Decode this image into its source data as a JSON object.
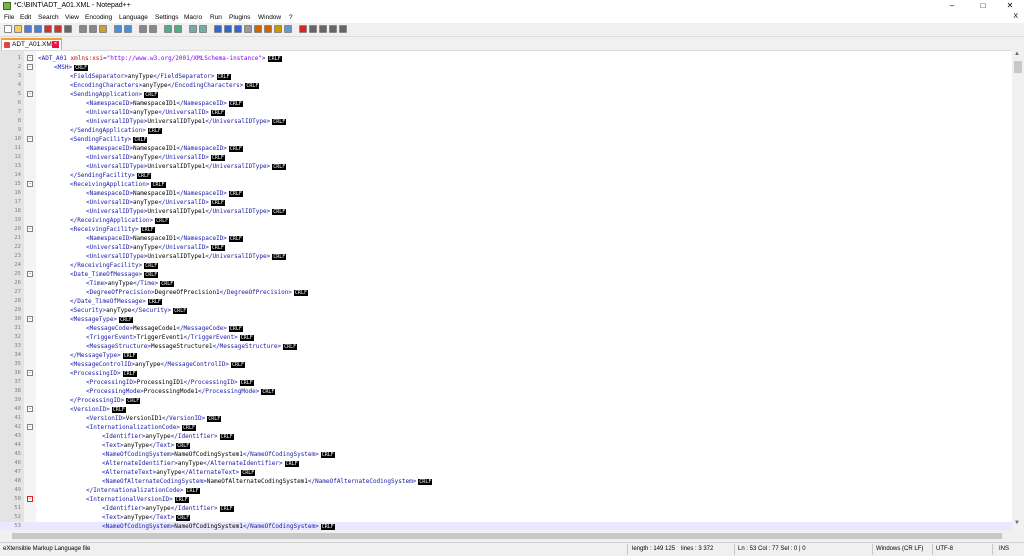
{
  "window": {
    "title": "*C:\\BINT\\ADT_A01.XML - Notepad++",
    "minimize": "–",
    "maximize": "□",
    "close": "✕"
  },
  "menu": [
    "File",
    "Edit",
    "Search",
    "View",
    "Encoding",
    "Language",
    "Settings",
    "Macro",
    "Run",
    "Plugins",
    "Window",
    "?"
  ],
  "menu_close": "X",
  "toolbar_icons": [
    "new-file-icon",
    "open-file-icon",
    "save-icon",
    "save-all-icon",
    "close-icon",
    "close-all-icon",
    "print-icon",
    "cut-icon",
    "copy-icon",
    "paste-icon",
    "undo-icon",
    "redo-icon",
    "find-icon",
    "replace-icon",
    "zoom-in-icon",
    "zoom-out-icon",
    "sync-vertical-icon",
    "sync-horizontal-icon",
    "word-wrap-icon",
    "show-all-chars-icon",
    "indent-guide-icon",
    "user-lang-icon",
    "doc-map-icon",
    "function-list-icon",
    "folder-workspace-icon",
    "monitoring-icon",
    "record-macro-icon",
    "stop-record-icon",
    "playback-icon",
    "run-macro-icon",
    "save-macro-icon"
  ],
  "tab": {
    "label": "ADT_A01.XML"
  },
  "crlf": "CRLF",
  "lines": [
    {
      "n": "1",
      "indent": 0,
      "segs": [
        [
          "t",
          "<ADT_A01 "
        ],
        [
          "a",
          "xmlns:xsi"
        ],
        [
          "t",
          "="
        ],
        [
          "v",
          "\"http://www.w3.org/2001/XMLSchema-instance\""
        ],
        [
          "t",
          ">"
        ]
      ]
    },
    {
      "n": "2",
      "indent": 1,
      "segs": [
        [
          "t",
          "<MSH>"
        ]
      ]
    },
    {
      "n": "3",
      "indent": 2,
      "segs": [
        [
          "t",
          "<FieldSeparator>"
        ],
        [
          "x",
          "anyType"
        ],
        [
          "t",
          "</FieldSeparator>"
        ]
      ]
    },
    {
      "n": "4",
      "indent": 2,
      "segs": [
        [
          "t",
          "<EncodingCharacters>"
        ],
        [
          "x",
          "anyType"
        ],
        [
          "t",
          "</EncodingCharacters>"
        ]
      ]
    },
    {
      "n": "5",
      "indent": 2,
      "segs": [
        [
          "t",
          "<SendingApplication>"
        ]
      ]
    },
    {
      "n": "6",
      "indent": 3,
      "segs": [
        [
          "t",
          "<NamespaceID>"
        ],
        [
          "x",
          "NamespaceID1"
        ],
        [
          "t",
          "</NamespaceID>"
        ]
      ]
    },
    {
      "n": "7",
      "indent": 3,
      "segs": [
        [
          "t",
          "<UniversalID>"
        ],
        [
          "x",
          "anyType"
        ],
        [
          "t",
          "</UniversalID>"
        ]
      ]
    },
    {
      "n": "8",
      "indent": 3,
      "segs": [
        [
          "t",
          "<UniversalIDType>"
        ],
        [
          "x",
          "UniversalIDType1"
        ],
        [
          "t",
          "</UniversalIDType>"
        ]
      ]
    },
    {
      "n": "9",
      "indent": 2,
      "segs": [
        [
          "t",
          "</SendingApplication>"
        ]
      ]
    },
    {
      "n": "10",
      "indent": 2,
      "segs": [
        [
          "t",
          "<SendingFacility>"
        ]
      ]
    },
    {
      "n": "11",
      "indent": 3,
      "segs": [
        [
          "t",
          "<NamespaceID>"
        ],
        [
          "x",
          "NamespaceID1"
        ],
        [
          "t",
          "</NamespaceID>"
        ]
      ]
    },
    {
      "n": "12",
      "indent": 3,
      "segs": [
        [
          "t",
          "<UniversalID>"
        ],
        [
          "x",
          "anyType"
        ],
        [
          "t",
          "</UniversalID>"
        ]
      ]
    },
    {
      "n": "13",
      "indent": 3,
      "segs": [
        [
          "t",
          "<UniversalIDType>"
        ],
        [
          "x",
          "UniversalIDType1"
        ],
        [
          "t",
          "</UniversalIDType>"
        ]
      ]
    },
    {
      "n": "14",
      "indent": 2,
      "segs": [
        [
          "t",
          "</SendingFacility>"
        ]
      ]
    },
    {
      "n": "15",
      "indent": 2,
      "segs": [
        [
          "t",
          "<ReceivingApplication>"
        ]
      ]
    },
    {
      "n": "16",
      "indent": 3,
      "segs": [
        [
          "t",
          "<NamespaceID>"
        ],
        [
          "x",
          "NamespaceID1"
        ],
        [
          "t",
          "</NamespaceID>"
        ]
      ]
    },
    {
      "n": "17",
      "indent": 3,
      "segs": [
        [
          "t",
          "<UniversalID>"
        ],
        [
          "x",
          "anyType"
        ],
        [
          "t",
          "</UniversalID>"
        ]
      ]
    },
    {
      "n": "18",
      "indent": 3,
      "segs": [
        [
          "t",
          "<UniversalIDType>"
        ],
        [
          "x",
          "UniversalIDType1"
        ],
        [
          "t",
          "</UniversalIDType>"
        ]
      ]
    },
    {
      "n": "19",
      "indent": 2,
      "segs": [
        [
          "t",
          "</ReceivingApplication>"
        ]
      ]
    },
    {
      "n": "20",
      "indent": 2,
      "segs": [
        [
          "t",
          "<ReceivingFacility>"
        ]
      ]
    },
    {
      "n": "21",
      "indent": 3,
      "segs": [
        [
          "t",
          "<NamespaceID>"
        ],
        [
          "x",
          "NamespaceID1"
        ],
        [
          "t",
          "</NamespaceID>"
        ]
      ]
    },
    {
      "n": "22",
      "indent": 3,
      "segs": [
        [
          "t",
          "<UniversalID>"
        ],
        [
          "x",
          "anyType"
        ],
        [
          "t",
          "</UniversalID>"
        ]
      ]
    },
    {
      "n": "23",
      "indent": 3,
      "segs": [
        [
          "t",
          "<UniversalIDType>"
        ],
        [
          "x",
          "UniversalIDType1"
        ],
        [
          "t",
          "</UniversalIDType>"
        ]
      ]
    },
    {
      "n": "24",
      "indent": 2,
      "segs": [
        [
          "t",
          "</ReceivingFacility>"
        ]
      ]
    },
    {
      "n": "25",
      "indent": 2,
      "segs": [
        [
          "t",
          "<Date_TimeOfMessage>"
        ]
      ]
    },
    {
      "n": "26",
      "indent": 3,
      "segs": [
        [
          "t",
          "<Time>"
        ],
        [
          "x",
          "anyType"
        ],
        [
          "t",
          "</Time>"
        ]
      ]
    },
    {
      "n": "27",
      "indent": 3,
      "segs": [
        [
          "t",
          "<DegreeOfPrecision>"
        ],
        [
          "x",
          "DegreeOfPrecision1"
        ],
        [
          "t",
          "</DegreeOfPrecision>"
        ]
      ]
    },
    {
      "n": "28",
      "indent": 2,
      "segs": [
        [
          "t",
          "</Date_TimeOfMessage>"
        ]
      ]
    },
    {
      "n": "29",
      "indent": 2,
      "segs": [
        [
          "t",
          "<Security>"
        ],
        [
          "x",
          "anyType"
        ],
        [
          "t",
          "</Security>"
        ]
      ]
    },
    {
      "n": "30",
      "indent": 2,
      "segs": [
        [
          "t",
          "<MessageType>"
        ]
      ]
    },
    {
      "n": "31",
      "indent": 3,
      "segs": [
        [
          "t",
          "<MessageCode>"
        ],
        [
          "x",
          "MessageCode1"
        ],
        [
          "t",
          "</MessageCode>"
        ]
      ]
    },
    {
      "n": "32",
      "indent": 3,
      "segs": [
        [
          "t",
          "<TriggerEvent>"
        ],
        [
          "x",
          "TriggerEvent1"
        ],
        [
          "t",
          "</TriggerEvent>"
        ]
      ]
    },
    {
      "n": "33",
      "indent": 3,
      "segs": [
        [
          "t",
          "<MessageStructure>"
        ],
        [
          "x",
          "MessageStructure1"
        ],
        [
          "t",
          "</MessageStructure>"
        ]
      ]
    },
    {
      "n": "34",
      "indent": 2,
      "segs": [
        [
          "t",
          "</MessageType>"
        ]
      ]
    },
    {
      "n": "35",
      "indent": 2,
      "segs": [
        [
          "t",
          "<MessageControlID>"
        ],
        [
          "x",
          "anyType"
        ],
        [
          "t",
          "</MessageControlID>"
        ]
      ]
    },
    {
      "n": "36",
      "indent": 2,
      "segs": [
        [
          "t",
          "<ProcessingID>"
        ]
      ]
    },
    {
      "n": "37",
      "indent": 3,
      "segs": [
        [
          "t",
          "<ProcessingID>"
        ],
        [
          "x",
          "ProcessingID1"
        ],
        [
          "t",
          "</ProcessingID>"
        ]
      ]
    },
    {
      "n": "38",
      "indent": 3,
      "segs": [
        [
          "t",
          "<ProcessingMode>"
        ],
        [
          "x",
          "ProcessingMode1"
        ],
        [
          "t",
          "</ProcessingMode>"
        ]
      ]
    },
    {
      "n": "39",
      "indent": 2,
      "segs": [
        [
          "t",
          "</ProcessingID>"
        ]
      ]
    },
    {
      "n": "40",
      "indent": 2,
      "segs": [
        [
          "t",
          "<VersionID>"
        ]
      ]
    },
    {
      "n": "41",
      "indent": 3,
      "segs": [
        [
          "t",
          "<VersionID>"
        ],
        [
          "x",
          "VersionID1"
        ],
        [
          "t",
          "</VersionID>"
        ]
      ]
    },
    {
      "n": "42",
      "indent": 3,
      "segs": [
        [
          "t",
          "<InternationalizationCode>"
        ]
      ]
    },
    {
      "n": "43",
      "indent": 4,
      "segs": [
        [
          "t",
          "<Identifier>"
        ],
        [
          "x",
          "anyType"
        ],
        [
          "t",
          "</Identifier>"
        ]
      ]
    },
    {
      "n": "44",
      "indent": 4,
      "segs": [
        [
          "t",
          "<Text>"
        ],
        [
          "x",
          "anyType"
        ],
        [
          "t",
          "</Text>"
        ]
      ]
    },
    {
      "n": "45",
      "indent": 4,
      "segs": [
        [
          "t",
          "<NameOfCodingSystem>"
        ],
        [
          "x",
          "NameOfCodingSystem1"
        ],
        [
          "t",
          "</NameOfCodingSystem>"
        ]
      ]
    },
    {
      "n": "46",
      "indent": 4,
      "segs": [
        [
          "t",
          "<AlternateIdentifier>"
        ],
        [
          "x",
          "anyType"
        ],
        [
          "t",
          "</AlternateIdentifier>"
        ]
      ]
    },
    {
      "n": "47",
      "indent": 4,
      "segs": [
        [
          "t",
          "<AlternateText>"
        ],
        [
          "x",
          "anyType"
        ],
        [
          "t",
          "</AlternateText>"
        ]
      ]
    },
    {
      "n": "48",
      "indent": 4,
      "segs": [
        [
          "t",
          "<NameOfAlternateCodingSystem>"
        ],
        [
          "x",
          "NameOfAlternateCodingSystem1"
        ],
        [
          "t",
          "</NameOfAlternateCodingSystem>"
        ]
      ]
    },
    {
      "n": "49",
      "indent": 3,
      "segs": [
        [
          "t",
          "</InternationalizationCode>"
        ]
      ]
    },
    {
      "n": "50",
      "indent": 3,
      "segs": [
        [
          "t",
          "<InternationalVersionID>"
        ]
      ]
    },
    {
      "n": "51",
      "indent": 4,
      "segs": [
        [
          "t",
          "<Identifier>"
        ],
        [
          "x",
          "anyType"
        ],
        [
          "t",
          "</Identifier>"
        ]
      ]
    },
    {
      "n": "52",
      "indent": 4,
      "segs": [
        [
          "t",
          "<Text>"
        ],
        [
          "x",
          "anyType"
        ],
        [
          "t",
          "</Text>"
        ]
      ]
    },
    {
      "n": "53",
      "indent": 4,
      "segs": [
        [
          "t",
          "<NameOfCodingSystem>"
        ],
        [
          "x",
          "NameOfCodingSystem1"
        ],
        [
          "t",
          "</NameOfCodingSystem>"
        ]
      ]
    }
  ],
  "current_line": "53",
  "fold_open_lines": [
    "1",
    "2",
    "5",
    "10",
    "15",
    "20",
    "25",
    "30",
    "36",
    "40",
    "42"
  ],
  "fold_red_lines": [
    "50"
  ],
  "status": {
    "file_type": "eXtensible Markup Language file",
    "length": "length : 149 125",
    "lines": "lines : 3 372",
    "position": "Ln : 53    Col : 77    Sel : 0 | 0",
    "eol": "Windows (CR LF)",
    "encoding": "UTF-8",
    "mode": "INS"
  },
  "colors": {
    "tag": "#1a1aa6",
    "attr": "#d10000",
    "value": "#8000ff"
  }
}
